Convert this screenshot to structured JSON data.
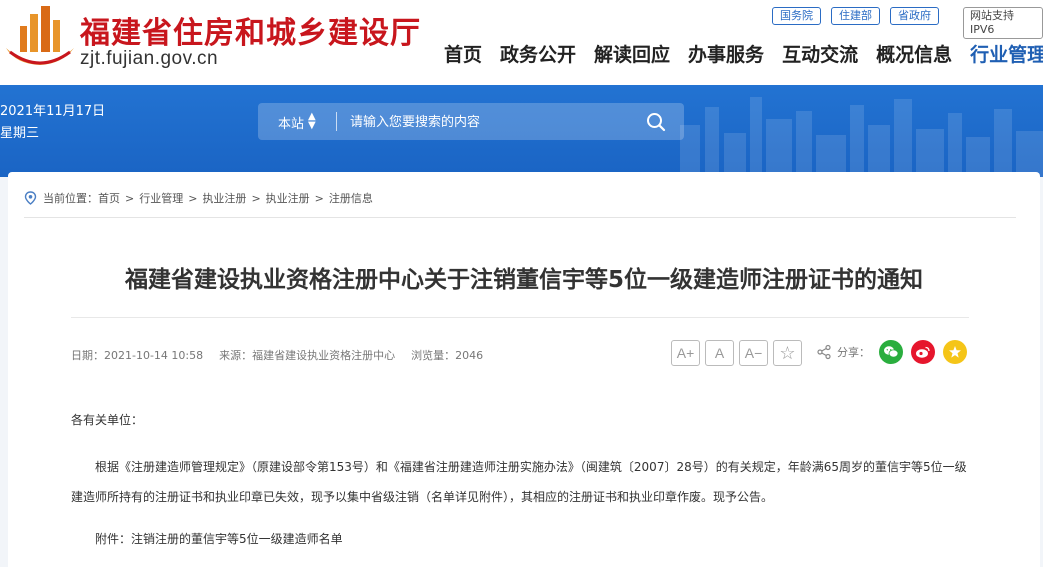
{
  "header": {
    "site_title": "福建省住房和城乡建设厅",
    "site_domain": "zjt.fujian.gov.cn",
    "top_links": [
      "国务院",
      "住建部",
      "省政府"
    ],
    "ipv6": "网站支持IPV6",
    "nav": [
      "首页",
      "政务公开",
      "解读回应",
      "办事服务",
      "互动交流",
      "概况信息",
      "行业管理"
    ],
    "active_nav": "行业管理"
  },
  "banner": {
    "date": "2021年11月17日",
    "weekday": "星期三",
    "search_scope": "本站",
    "search_placeholder": "请输入您要搜索的内容"
  },
  "breadcrumb": {
    "prefix": "当前位置：",
    "items": [
      "首页",
      "行业管理",
      "执业注册",
      "执业注册",
      "注册信息"
    ]
  },
  "article": {
    "title": "福建省建设执业资格注册中心关于注销董信宇等5位一级建造师注册证书的通知",
    "date_label": "日期：2021-10-14 10:58",
    "source_label": "来源：福建省建设执业资格注册中心",
    "views_label": "浏览量：2046",
    "greeting": "各有关单位：",
    "paragraph": "根据《注册建造师管理规定》（原建设部令第153号）和《福建省注册建造师注册实施办法》（闽建筑〔2007〕28号）的有关规定，年龄满65周岁的董信宇等5位一级建造师所持有的注册证书和执业印章已失效，现予以集中省级注销（名单详见附件），其相应的注册证书和执业印章作废。现予公告。",
    "attachment": "附件：注销注册的董信宇等5位一级建造师名单"
  },
  "tools": {
    "font_larger": "A+",
    "font_normal": "A",
    "font_smaller": "A−",
    "favorite": "☆"
  },
  "share": {
    "label": "分享："
  },
  "colors": {
    "brand_red": "#c8161d",
    "nav_active": "#1f5fb3",
    "banner_blue": "#1a64c4",
    "wechat": "#2aae3e",
    "weibo": "#e6162d",
    "qzone": "#f5c518"
  }
}
